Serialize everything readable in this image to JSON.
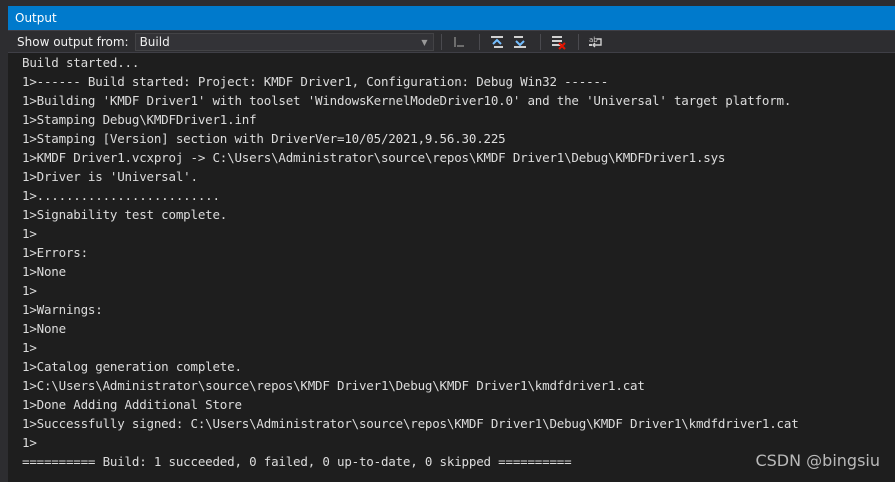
{
  "panel": {
    "title": "Output"
  },
  "toolbar": {
    "show_output_label": "Show output from:",
    "source_selected": "Build",
    "buttons": [
      {
        "name": "go-to-previous-message-icon"
      },
      {
        "name": "find-previous-icon"
      },
      {
        "name": "find-next-icon"
      },
      {
        "name": "clear-all-icon"
      },
      {
        "name": "toggle-word-wrap-icon"
      }
    ]
  },
  "output": {
    "lines": [
      "Build started...",
      "1>------ Build started: Project: KMDF Driver1, Configuration: Debug Win32 ------",
      "1>Building 'KMDF Driver1' with toolset 'WindowsKernelModeDriver10.0' and the 'Universal' target platform.",
      "1>Stamping Debug\\KMDFDriver1.inf",
      "1>Stamping [Version] section with DriverVer=10/05/2021,9.56.30.225",
      "1>KMDF Driver1.vcxproj -> C:\\Users\\Administrator\\source\\repos\\KMDF Driver1\\Debug\\KMDFDriver1.sys",
      "1>Driver is 'Universal'.",
      "1>.........................",
      "1>Signability test complete.",
      "1>",
      "1>Errors:",
      "1>None",
      "1>",
      "1>Warnings:",
      "1>None",
      "1>",
      "1>Catalog generation complete.",
      "1>C:\\Users\\Administrator\\source\\repos\\KMDF Driver1\\Debug\\KMDF Driver1\\kmdfdriver1.cat",
      "1>Done Adding Additional Store",
      "1>Successfully signed: C:\\Users\\Administrator\\source\\repos\\KMDF Driver1\\Debug\\KMDF Driver1\\kmdfdriver1.cat",
      "1>",
      "========== Build: 1 succeeded, 0 failed, 0 up-to-date, 0 skipped =========="
    ]
  },
  "watermark": "CSDN @bingsiu",
  "colors": {
    "title_bar": "#007acc",
    "background": "#1e1e1e",
    "toolbar": "#2d2d30",
    "text": "#dcdcdc"
  }
}
